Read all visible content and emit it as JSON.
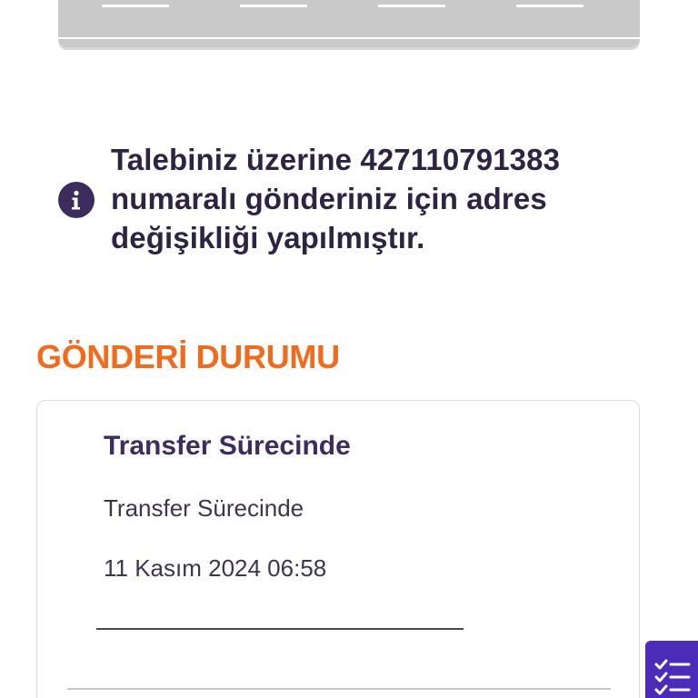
{
  "notice": {
    "icon": "info-icon",
    "text": "Talebiniz üzerine 427110791383 numaralı gönderiniz için adres değişikliği yapılmıştır."
  },
  "shipment_status": {
    "section_title": "GÖNDERİ DURUMU",
    "status_title": "Transfer Sürecinde",
    "status_description": "Transfer Sürecinde",
    "status_datetime": "11 Kasım 2024 06:58"
  },
  "floating_action": {
    "icon": "checklist-icon"
  },
  "colors": {
    "accent_orange": "#f26b1d",
    "primary_purple": "#3d2d5f",
    "fab_purple": "#4b2bb8",
    "road_gray": "#c9c9c9"
  }
}
